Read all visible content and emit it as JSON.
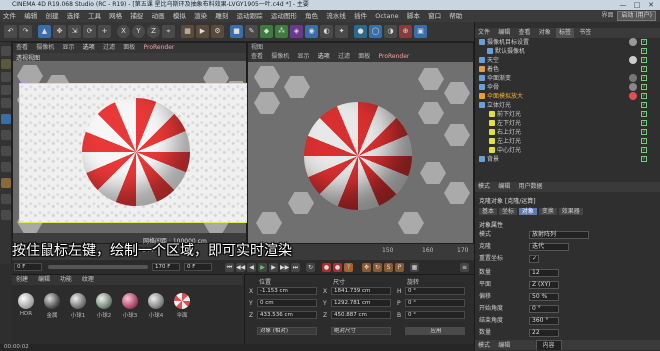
{
  "window": {
    "title": "CINEMA 4D R19.068 Studio (RC - R19) - [第五课 星比乌斯环及抽象布料效果-LVGY1905一叶.c4d *] - 主要",
    "min_label": "—",
    "max_label": "□",
    "close_label": "✕"
  },
  "menubar": {
    "items": [
      "文件",
      "编辑",
      "创建",
      "选择",
      "工具",
      "网格",
      "捕捉",
      "动画",
      "模拟",
      "渲染",
      "雕刻",
      "运动跟踪",
      "运动图形",
      "角色",
      "流水线",
      "插件",
      "Octane",
      "脚本",
      "窗口",
      "帮助"
    ],
    "interface_label": "界面",
    "interface_value": "启动 (用户)"
  },
  "toolbar": {
    "icons": [
      "undo-icon",
      "redo-icon",
      "select-icon",
      "move-icon",
      "scale-icon",
      "rotate-icon",
      "add-icon",
      "x-axis-icon",
      "y-axis-icon",
      "z-axis-icon",
      "coord-icon",
      "render-region-icon",
      "render-view-icon",
      "render-settings-icon",
      "cube-icon",
      "pen-icon",
      "subdivide-icon",
      "array-icon",
      "deformer-icon",
      "scene-icon",
      "camera-icon",
      "light-icon",
      "tag-icon",
      "sphere-icon",
      "python-icon",
      "snap-icon",
      "grid-icon"
    ],
    "axis_x": "X",
    "axis_y": "Y",
    "axis_z": "Z"
  },
  "left_viewport": {
    "menu": [
      "查看",
      "摄像机",
      "显示",
      "选项",
      "过滤",
      "面板",
      "ProRender"
    ],
    "title": "透视视图",
    "footer": "网格间距 : 100000 cm"
  },
  "right_viewport": {
    "tab": "视图",
    "menu": [
      "查看",
      "摄像机",
      "显示",
      "选项",
      "过滤",
      "面板",
      "ProRender"
    ]
  },
  "subtitle": "按住鼠标左键，绘制一个区域，即可实时渲染",
  "timeline": {
    "start": "0 F",
    "end": "170 F",
    "ticks": [
      "144",
      "150",
      "160",
      "170"
    ],
    "current": "0 F"
  },
  "materials": {
    "menu": [
      "创建",
      "编辑",
      "功能",
      "纹理"
    ],
    "items": [
      {
        "label": "HDR",
        "color": "#d8d8d8"
      },
      {
        "label": "金属",
        "color": "#888888"
      },
      {
        "label": "小球1",
        "color": "#9a9a9a"
      },
      {
        "label": "小球2",
        "color": "#a0a0a0"
      },
      {
        "label": "小球3",
        "color": "#c86a8a"
      },
      {
        "label": "小球4",
        "color": "#b0b0b0"
      },
      {
        "label": "伞面",
        "color": "#e05050"
      }
    ]
  },
  "coords": {
    "headers": [
      "位置",
      "尺寸",
      "旋转"
    ],
    "rows": [
      {
        "axis": "X",
        "pos": "-1.153 cm",
        "size_axis": "X",
        "size": "1841.739 cm",
        "rot_axis": "H",
        "rot": "0 °"
      },
      {
        "axis": "Y",
        "pos": "0 cm",
        "size_axis": "Y",
        "size": "1292.781 cm",
        "rot_axis": "P",
        "rot": "0 °"
      },
      {
        "axis": "Z",
        "pos": "433.536 cm",
        "size_axis": "Z",
        "size": "450.887 cm",
        "rot_axis": "B",
        "rot": "0 °"
      }
    ],
    "mode1": "对象 (相对)",
    "mode2": "绝对尺寸",
    "apply": "应用"
  },
  "objects_panel": {
    "tabs": [
      "文件",
      "编辑",
      "查看",
      "对象",
      "标签",
      "书签"
    ],
    "items": [
      {
        "name": "摄像机目标设置",
        "indent": 0,
        "color": "#6aa0d8"
      },
      {
        "name": "默认摄像机",
        "indent": 1,
        "color": "#6aa0d8"
      },
      {
        "name": "天空",
        "indent": 0,
        "color": "#6aa0d8"
      },
      {
        "name": "着色",
        "indent": 0,
        "color": "#e0a040"
      },
      {
        "name": "伞面渐变",
        "indent": 0,
        "color": "#6aa0d8"
      },
      {
        "name": "伞骨",
        "indent": 0,
        "color": "#6aa0d8"
      },
      {
        "name": "伞面模拟放大",
        "indent": 0,
        "color": "#e8a030"
      },
      {
        "name": "立体灯光",
        "indent": 0,
        "color": "#6aa0d8"
      },
      {
        "name": "前下灯光",
        "indent": 1,
        "color": "#e0e040"
      },
      {
        "name": "左下灯光",
        "indent": 1,
        "color": "#e0e040"
      },
      {
        "name": "右上灯光",
        "indent": 1,
        "color": "#e0e040"
      },
      {
        "name": "左上灯光",
        "indent": 1,
        "color": "#e0e040"
      },
      {
        "name": "中心灯光",
        "indent": 1,
        "color": "#e0e040"
      },
      {
        "name": "背景",
        "indent": 0,
        "color": "#6aa0d8"
      }
    ]
  },
  "attributes": {
    "tabs": [
      "模式",
      "编辑",
      "用户数据"
    ],
    "object_title": "克隆对象 [克隆/运算]",
    "subtabs": [
      "基本",
      "坐标",
      "对象",
      "变换",
      "效果器"
    ],
    "section": "对象属性",
    "rows": [
      {
        "label": "模式",
        "value": "放射阵列"
      },
      {
        "label": "克隆",
        "value": "迭代"
      },
      {
        "label": "重置坐标",
        "value": "✓"
      },
      {
        "label": "数量",
        "value": "12"
      },
      {
        "label": "平面",
        "value": "Z (XY)"
      },
      {
        "label": "偏移",
        "value": "50 %"
      },
      {
        "label": "开始角度",
        "value": "0 °"
      },
      {
        "label": "结束角度",
        "value": "360 °"
      },
      {
        "label": "数量",
        "value": "22"
      }
    ],
    "bottom_tabs": [
      "模式",
      "编辑"
    ],
    "bottom_value": "内容"
  },
  "statusbar": {
    "time": "00:00:02"
  }
}
